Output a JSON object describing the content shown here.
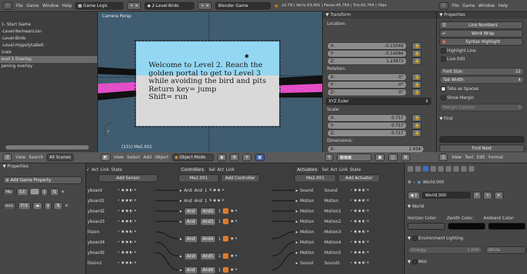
{
  "top_header": {
    "info_btn": "ⓘ",
    "menus": [
      "File",
      "Game",
      "Window",
      "Help"
    ],
    "layout": "Game Logic",
    "scene": "2-Level-Birds",
    "engine": "Blender Game",
    "stats": "v2.79 | Verts:53,491 | Faces:45,764 | Tris:83,764 | Obje"
  },
  "right_header": {
    "menus": [
      "File",
      "Game",
      "Window",
      "Help"
    ]
  },
  "outliner": {
    "items": [
      "1- Start Game",
      "-Level-NemeanLion",
      "-Level-Birds",
      "-Level-HippolytaBelt",
      "inale",
      "evel 1 Overlay",
      "pening overlay"
    ],
    "selected_index": 5
  },
  "viewport": {
    "label": "Camera Persp",
    "object_label": "(131) Me2.001",
    "overlay_text": [
      "Welcome to Level 2. Reach the",
      "golden portal to get to Level 3",
      "while avoiding the bird and pits",
      "Return key= jump",
      "Shift= run"
    ]
  },
  "transform": {
    "title": "Transform",
    "location_label": "Location:",
    "location": [
      {
        "k": "X:",
        "v": "-0.15049"
      },
      {
        "k": "Y:",
        "v": "-5.14284"
      },
      {
        "k": "Z:",
        "v": "1.23873"
      }
    ],
    "rotation_label": "Rotation:",
    "rotation": [
      {
        "k": "X:",
        "v": "0°"
      },
      {
        "k": "Y:",
        "v": "-0°"
      },
      {
        "k": "Z:",
        "v": "0°"
      }
    ],
    "euler": "XYZ Euler",
    "scale_label": "Scale:",
    "scale": [
      {
        "k": "X:",
        "v": "0.717"
      },
      {
        "k": "Y:",
        "v": "0.717"
      },
      {
        "k": "Z:",
        "v": "0.717"
      }
    ],
    "dimensions_label": "Dimensions:",
    "dimensions": [
      {
        "k": "X:",
        "v": "1.434"
      }
    ]
  },
  "text_props": {
    "title": "Properties",
    "line_numbers": "Line Numbers",
    "word_wrap": "Word Wrap",
    "syntax_highlight": "Syntax Highlight",
    "highlight_line": "Highlight Line",
    "live_edit": "Live Edit",
    "font_size_label": "Font Size:",
    "font_size": "12",
    "tab_width_label": "Tab Width:",
    "tab_width": "4",
    "tabs_as_spaces": "Tabs as Spaces",
    "show_margin": "Show Margin",
    "margin_column_label": "Margin Column:",
    "margin_column": "0",
    "find_title": "Find",
    "find_next": "Find Next"
  },
  "viewport_header": {
    "menus": [
      "View",
      "Select",
      "Add",
      "Object"
    ],
    "mode": "Object Mode"
  },
  "outliner_header": {
    "menus": [
      "View",
      "Search"
    ],
    "filter": "All Scenes"
  },
  "text_header": {
    "menus": [
      "View",
      "Text",
      "Edit",
      "Format"
    ]
  },
  "game_props": {
    "title": "Properties",
    "add_button": "Add Game Property",
    "row1_name": "Me",
    "row2_name": "evo"
  },
  "logic": {
    "sensors_header": {
      "act": "Act",
      "link": "Link",
      "state": "State",
      "add": "Add Sensor"
    },
    "controllers_header": {
      "title": "Controllers",
      "sel": "Sel",
      "act": "Act",
      "link": "Link",
      "obj": "Me2.001",
      "add": "Add Controller"
    },
    "actuators_header": {
      "title": "Actuators",
      "sel": "Sel",
      "act": "Act",
      "link": "Link",
      "state": "State",
      "obj": "Me2.001",
      "add": "Add Actuator"
    },
    "sensors": [
      "yboard",
      "yboard1",
      "yboard2",
      "yboard3",
      "llision",
      "yboard4",
      "yboard5",
      "llision1"
    ],
    "controllers": [
      {
        "type": "And",
        "name": "And",
        "n": "1"
      },
      {
        "type": "And",
        "name": "And",
        "n": "1"
      },
      {
        "type": "And",
        "name": "And2",
        "n": "1"
      },
      {
        "type": "And",
        "name": "And3",
        "n": "1"
      },
      {
        "type": "And",
        "name": "And4",
        "n": "1"
      },
      {
        "type": "And",
        "name": "And5",
        "n": "1"
      },
      {
        "type": "And",
        "name": "And6",
        "n": "1"
      }
    ],
    "actuators": [
      {
        "type": "Sound",
        "name": "Sound"
      },
      {
        "type": "Motion",
        "name": "Motion"
      },
      {
        "type": "Motion",
        "name": "Motion1"
      },
      {
        "type": "Motion",
        "name": "Motion2"
      },
      {
        "type": "Motion",
        "name": "Motion3"
      },
      {
        "type": "Motion",
        "name": "Motion4"
      },
      {
        "type": "Motion",
        "name": "Motion5"
      },
      {
        "type": "Sound",
        "name": "Sound1"
      }
    ]
  },
  "world": {
    "breadcrumb": "World.000",
    "datablock": "World.000",
    "f_label": "F",
    "section": "World",
    "horizon_color": "Horizon Color:",
    "zenith_color": "Zenith Color:",
    "ambient_color": "Ambient Color:",
    "env_lighting": "Environment Lighting",
    "energy_label": "Energy:",
    "energy": "1.000",
    "white": "White",
    "mist": "Mist"
  }
}
